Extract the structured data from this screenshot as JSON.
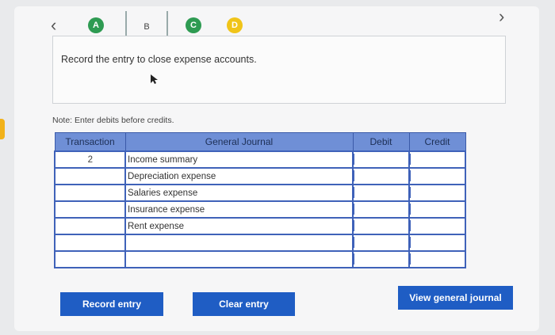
{
  "steps": [
    {
      "label": "A"
    },
    {
      "label": "B"
    },
    {
      "label": "C"
    },
    {
      "label": "D"
    }
  ],
  "instruction": "Record the entry to close expense accounts.",
  "note": "Note: Enter debits before credits.",
  "table": {
    "headers": {
      "transaction": "Transaction",
      "general_journal": "General Journal",
      "debit": "Debit",
      "credit": "Credit"
    },
    "rows": [
      {
        "transaction": "2",
        "account": "Income summary",
        "debit": "",
        "credit": ""
      },
      {
        "transaction": "",
        "account": "Depreciation expense",
        "debit": "",
        "credit": ""
      },
      {
        "transaction": "",
        "account": "Salaries expense",
        "debit": "",
        "credit": ""
      },
      {
        "transaction": "",
        "account": "Insurance expense",
        "debit": "",
        "credit": ""
      },
      {
        "transaction": "",
        "account": "Rent expense",
        "debit": "",
        "credit": ""
      },
      {
        "transaction": "",
        "account": "",
        "debit": "",
        "credit": ""
      },
      {
        "transaction": "",
        "account": "",
        "debit": "",
        "credit": ""
      }
    ]
  },
  "buttons": {
    "record": "Record entry",
    "clear": "Clear entry",
    "view": "View general journal"
  },
  "colors": {
    "accent": "#1f5dc4",
    "step_done": "#2e9b52",
    "step_pending": "#f0c419",
    "header": "#6f8fd6"
  }
}
